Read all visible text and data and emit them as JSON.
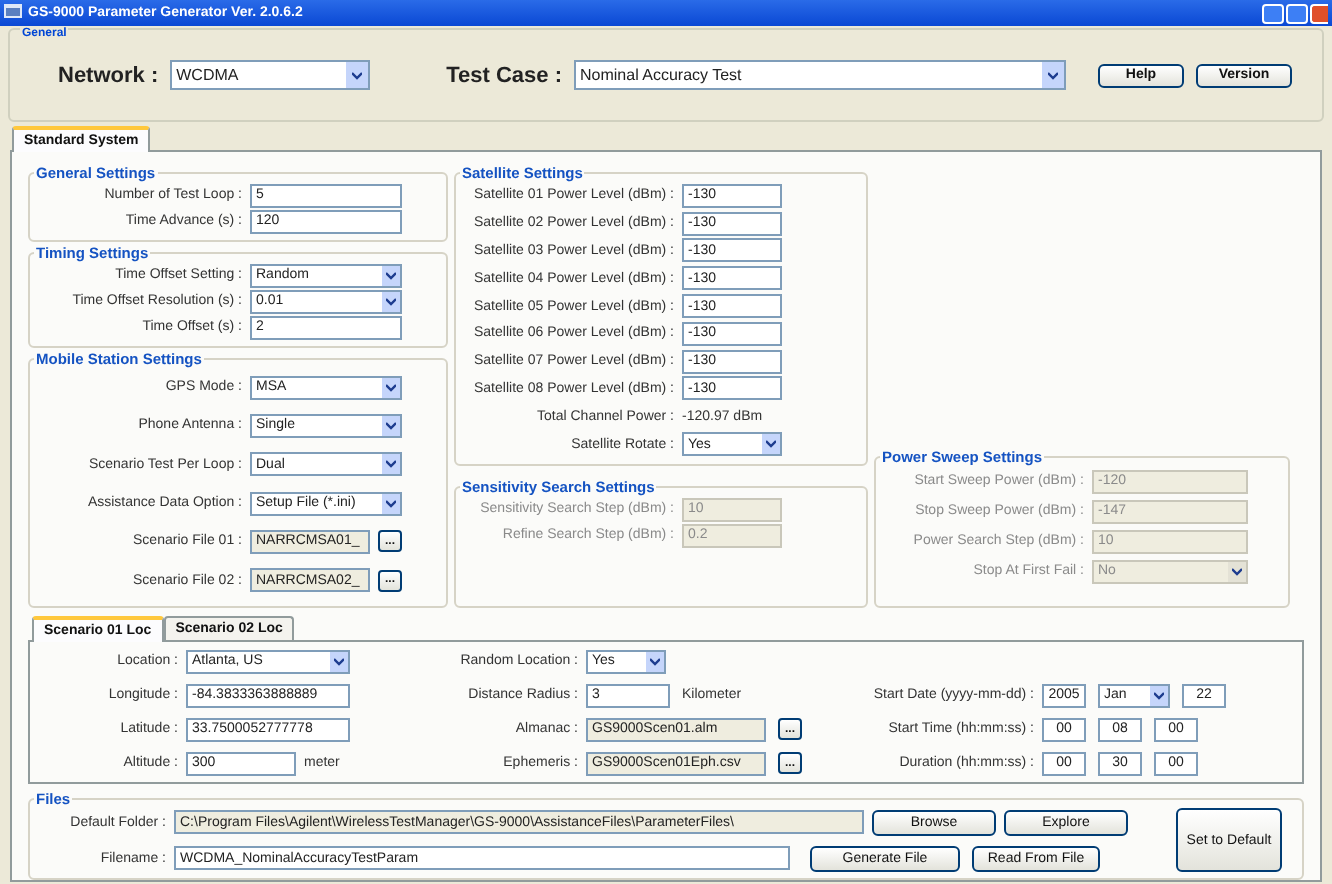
{
  "window": {
    "title": "GS-9000 Parameter Generator Ver. 2.0.6.2"
  },
  "general": {
    "title": "General",
    "network": {
      "label": "Network :",
      "value": "WCDMA"
    },
    "test_case": {
      "label": "Test Case :",
      "value": "Nominal Accuracy Test"
    },
    "buttons": [
      "Help",
      "Version"
    ]
  },
  "tabs": [
    {
      "label": "Standard System",
      "selected": true
    }
  ],
  "settings_columns": [
    [
      {
        "title": "General Settings",
        "disabled": false,
        "rows": [
          {
            "label": "Number of Test Loop :",
            "controls": [
              {
                "kind": "input",
                "value": "5"
              }
            ]
          },
          {
            "label": "Time Advance (s) :",
            "controls": [
              {
                "kind": "input",
                "value": "120"
              }
            ]
          }
        ]
      },
      {
        "title": "Timing Settings",
        "disabled": false,
        "rows": [
          {
            "label": "Time Offset Setting :",
            "controls": [
              {
                "kind": "select",
                "value": "Random"
              }
            ]
          },
          {
            "label": "Time Offset Resolution (s) :",
            "controls": [
              {
                "kind": "select",
                "value": "0.01"
              }
            ]
          },
          {
            "label": "Time Offset (s) :",
            "controls": [
              {
                "kind": "input",
                "value": "2"
              }
            ]
          }
        ]
      },
      {
        "title": "Mobile Station Settings",
        "disabled": false,
        "rows": [
          {
            "label": "GPS Mode :",
            "controls": [
              {
                "kind": "select",
                "value": "MSA"
              }
            ]
          },
          {
            "label": "Phone Antenna :",
            "controls": [
              {
                "kind": "select",
                "value": "Single"
              }
            ]
          },
          {
            "label": "Scenario Test Per Loop :",
            "controls": [
              {
                "kind": "select",
                "value": "Dual"
              }
            ]
          },
          {
            "label": "Assistance Data Option :",
            "controls": [
              {
                "kind": "select",
                "value": "Setup File (*.ini)"
              }
            ]
          },
          {
            "label": "Scenario File 01 :",
            "controls": [
              {
                "kind": "file",
                "value": "NARRCMSA01_",
                "button": "..."
              }
            ]
          },
          {
            "label": "Scenario File 02 :",
            "controls": [
              {
                "kind": "file",
                "value": "NARRCMSA02_",
                "button": "..."
              }
            ]
          }
        ]
      }
    ],
    [
      {
        "title": "Satellite Settings",
        "disabled": false,
        "rows": [
          {
            "label": "Satellite 01 Power Level (dBm) :",
            "controls": [
              {
                "kind": "input",
                "value": "-130"
              }
            ]
          },
          {
            "label": "Satellite 02 Power Level (dBm) :",
            "controls": [
              {
                "kind": "input",
                "value": "-130"
              }
            ]
          },
          {
            "label": "Satellite 03 Power Level (dBm) :",
            "controls": [
              {
                "kind": "input",
                "value": "-130"
              }
            ]
          },
          {
            "label": "Satellite 04 Power Level (dBm) :",
            "controls": [
              {
                "kind": "input",
                "value": "-130"
              }
            ]
          },
          {
            "label": "Satellite 05 Power Level (dBm) :",
            "controls": [
              {
                "kind": "input",
                "value": "-130"
              }
            ]
          },
          {
            "label": "Satellite 06 Power Level (dBm) :",
            "controls": [
              {
                "kind": "input",
                "value": "-130"
              }
            ]
          },
          {
            "label": "Satellite 07 Power Level (dBm) :",
            "controls": [
              {
                "kind": "input",
                "value": "-130"
              }
            ]
          },
          {
            "label": "Satellite 08 Power Level (dBm) :",
            "controls": [
              {
                "kind": "input",
                "value": "-130"
              }
            ]
          },
          {
            "label": "Total Channel Power :",
            "controls": [
              {
                "kind": "display",
                "value": "-120.97 dBm"
              }
            ]
          },
          {
            "label": "Satellite Rotate :",
            "controls": [
              {
                "kind": "select",
                "value": "Yes"
              }
            ]
          }
        ]
      },
      {
        "title": "Sensitivity Search Settings",
        "disabled": true,
        "rows": [
          {
            "label": "Sensitivity Search Step (dBm) :",
            "controls": [
              {
                "kind": "input",
                "value": "10"
              }
            ]
          },
          {
            "label": "Refine Search Step (dBm) :",
            "controls": [
              {
                "kind": "input",
                "value": "0.2"
              }
            ]
          }
        ]
      }
    ],
    [
      {
        "title": "Power Sweep Settings",
        "disabled": true,
        "rows": [
          {
            "label": "Start Sweep Power (dBm) :",
            "controls": [
              {
                "kind": "input",
                "value": "-120"
              }
            ]
          },
          {
            "label": "Stop Sweep Power (dBm) :",
            "controls": [
              {
                "kind": "input",
                "value": "-147"
              }
            ]
          },
          {
            "label": "Power Search Step (dBm) :",
            "controls": [
              {
                "kind": "input",
                "value": "10"
              }
            ]
          },
          {
            "label": "Stop At First Fail :",
            "controls": [
              {
                "kind": "select",
                "value": "No"
              }
            ]
          }
        ]
      }
    ]
  ],
  "scenario_tabs": [
    {
      "label": "Scenario 01 Loc",
      "selected": true
    },
    {
      "label": "Scenario 02 Loc",
      "selected": false
    }
  ],
  "scenario_columns": [
    [
      {
        "label": "Location :",
        "controls": [
          {
            "kind": "select",
            "value": "Atlanta, US"
          }
        ]
      },
      {
        "label": "Longitude :",
        "controls": [
          {
            "kind": "input",
            "value": "-84.3833363888889"
          }
        ]
      },
      {
        "label": "Latitude :",
        "controls": [
          {
            "kind": "input",
            "value": "33.7500052777778"
          }
        ]
      },
      {
        "label": "Altitude :",
        "controls": [
          {
            "kind": "input",
            "value": "300"
          }
        ],
        "unit": "meter"
      }
    ],
    [
      {
        "label": "Random Location :",
        "controls": [
          {
            "kind": "select",
            "value": "Yes"
          }
        ]
      },
      {
        "label": "Distance Radius :",
        "controls": [
          {
            "kind": "input",
            "value": "3"
          }
        ],
        "unit": "Kilometer"
      },
      {
        "label": "Almanac :",
        "controls": [
          {
            "kind": "file",
            "value": "GS9000Scen01.alm",
            "button": "..."
          }
        ]
      },
      {
        "label": "Ephemeris :",
        "controls": [
          {
            "kind": "file",
            "value": "GS9000Scen01Eph.csv",
            "button": "..."
          }
        ]
      }
    ],
    [
      {
        "label": "Start Date (yyyy-mm-dd) :",
        "controls": [
          {
            "kind": "input",
            "value": "2005"
          },
          {
            "kind": "select",
            "value": "Jan"
          },
          {
            "kind": "input",
            "value": "22"
          }
        ]
      },
      {
        "label": "Start Time  (hh:mm:ss) :",
        "controls": [
          {
            "kind": "input",
            "value": "00"
          },
          {
            "kind": "input",
            "value": "08"
          },
          {
            "kind": "input",
            "value": "00"
          }
        ]
      },
      {
        "label": "Duration (hh:mm:ss) :",
        "controls": [
          {
            "kind": "input",
            "value": "00"
          },
          {
            "kind": "input",
            "value": "30"
          },
          {
            "kind": "input",
            "value": "00"
          }
        ]
      }
    ]
  ],
  "files": {
    "title": "Files",
    "rows": [
      {
        "label": "Default Folder :",
        "controls": [
          {
            "kind": "readonly",
            "value": "C:\\Program Files\\Agilent\\WirelessTestManager\\GS-9000\\AssistanceFiles\\ParameterFiles\\"
          }
        ],
        "buttons": [
          "Browse",
          "Explore"
        ]
      },
      {
        "label": "Filename :",
        "controls": [
          {
            "kind": "input",
            "value": "WCDMA_NominalAccuracyTestParam"
          }
        ],
        "buttons": [
          "Generate File",
          "Read From File"
        ]
      }
    ],
    "side_button": "Set to Default"
  }
}
